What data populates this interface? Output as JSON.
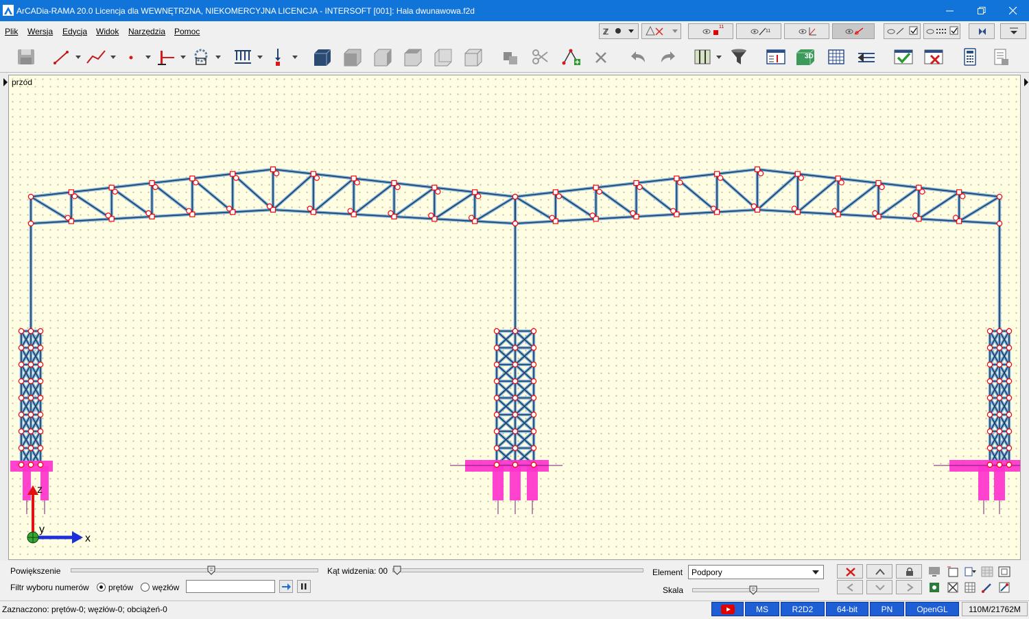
{
  "window": {
    "title": "ArCADia-RAMA 20.0 Licencja dla WEWNĘTRZNA, NIEKOMERCYJNA LICENCJA - INTERSOFT [001]: Hala dwunawowa.f2d"
  },
  "menu": {
    "items": [
      "Plik",
      "Wersja",
      "Edycja",
      "Widok",
      "Narzędzia",
      "Pomoc"
    ]
  },
  "tabs": {
    "badge_1": "11",
    "badge_2": "11"
  },
  "toolbar": {
    "button_icons": [
      "save-icon",
      "bar-icon",
      "polyline-icon",
      "node-icon",
      "support-icon",
      "section-icon",
      "distributed-load-icon",
      "point-load-icon",
      "view-3d-solid-icon",
      "view-front-icon",
      "view-side-icon",
      "view-top-icon",
      "view-left-icon",
      "view-iso-icon",
      "copy-icon",
      "cut-icon",
      "add-node-icon",
      "delete-icon",
      "undo-icon",
      "redo-icon",
      "columns-icon",
      "filter-icon",
      "properties-icon",
      "view-3d-icon",
      "table-icon",
      "import-icon",
      "check-icon",
      "clear-results-icon",
      "calculator-icon",
      "report-icon"
    ],
    "view3d_label": "3D"
  },
  "canvas": {
    "view_label": "przód",
    "axis_x": "x",
    "axis_y": "y",
    "axis_z": "z"
  },
  "bottom": {
    "zoom_label": "Powiększenie",
    "zoom_level": 0.57,
    "angle_label": "Kąt widzenia: 00",
    "angle_level": 0,
    "filter_label": "Filtr wyboru numerów",
    "radio_bars": "prętów",
    "radio_nodes": "węzłów",
    "filter_value": "",
    "element_label": "Element",
    "element_value": "Podpory",
    "scale_label": "Skala",
    "scale_level": 0.48
  },
  "status": {
    "text": "Zaznaczono: prętów-0; węzłów-0; obciążeń-0",
    "cells": [
      "MS",
      "R2D2",
      "64-bit",
      "PN",
      "OpenGL"
    ],
    "memory": "110M/21762M"
  },
  "colors": {
    "titlebar": "#1174d8",
    "canvas_bg": "#fffde2",
    "member": "#1c3f63",
    "member_halo": "#7fb1dc",
    "node": "#ff0000",
    "support": "#ff33cc",
    "status_cell": "#1f5fd6"
  }
}
